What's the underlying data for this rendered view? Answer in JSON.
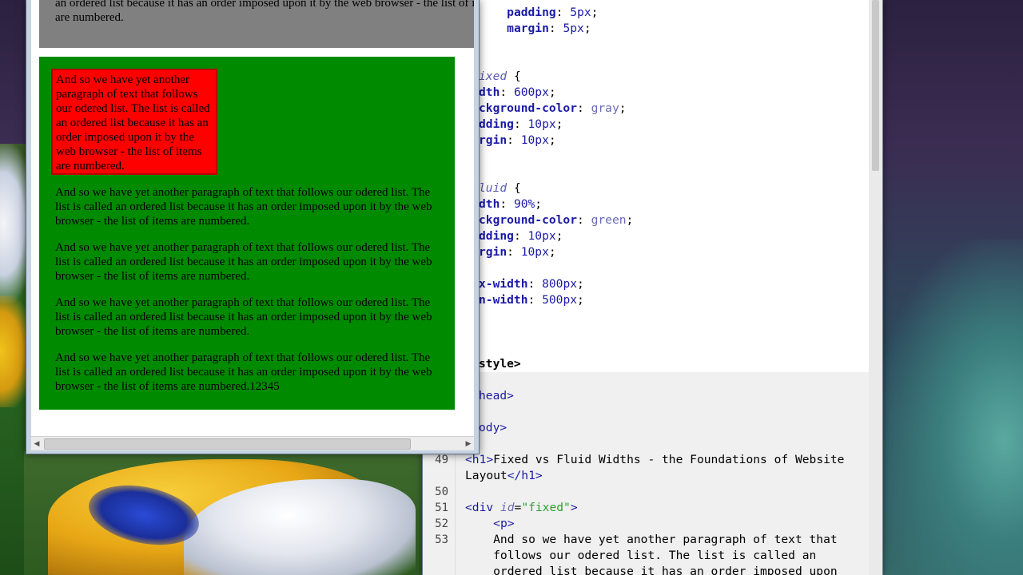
{
  "editor": {
    "top_lines": [
      {
        "parts": [
          [
            "prop",
            "padding"
          ],
          [
            "plain",
            ": "
          ],
          [
            "val-num",
            "5px"
          ],
          [
            "plain",
            ";"
          ]
        ],
        "indent": "    "
      },
      {
        "parts": [
          [
            "prop",
            "margin"
          ],
          [
            "plain",
            ": "
          ],
          [
            "val-num",
            "5px"
          ],
          [
            "plain",
            ";"
          ]
        ],
        "indent": "    "
      },
      {
        "parts": [],
        "indent": ""
      },
      {
        "parts": [],
        "indent": ""
      },
      {
        "parts": [
          [
            "sel",
            "ixed"
          ],
          [
            "plain",
            " {"
          ]
        ],
        "indent": ""
      },
      {
        "parts": [
          [
            "prop",
            "dth"
          ],
          [
            "plain",
            ": "
          ],
          [
            "val-num",
            "600px"
          ],
          [
            "plain",
            ";"
          ]
        ],
        "indent": ""
      },
      {
        "parts": [
          [
            "prop",
            "ckground-color"
          ],
          [
            "plain",
            ": "
          ],
          [
            "val-kw",
            "gray"
          ],
          [
            "plain",
            ";"
          ]
        ],
        "indent": ""
      },
      {
        "parts": [
          [
            "prop",
            "dding"
          ],
          [
            "plain",
            ": "
          ],
          [
            "val-num",
            "10px"
          ],
          [
            "plain",
            ";"
          ]
        ],
        "indent": ""
      },
      {
        "parts": [
          [
            "prop",
            "rgin"
          ],
          [
            "plain",
            ": "
          ],
          [
            "val-num",
            "10px"
          ],
          [
            "plain",
            ";"
          ]
        ],
        "indent": ""
      },
      {
        "parts": [],
        "indent": ""
      },
      {
        "parts": [],
        "indent": ""
      },
      {
        "parts": [
          [
            "sel",
            "luid"
          ],
          [
            "plain",
            " {"
          ]
        ],
        "indent": ""
      },
      {
        "parts": [
          [
            "prop",
            "dth"
          ],
          [
            "plain",
            ": "
          ],
          [
            "val-num",
            "90%"
          ],
          [
            "plain",
            ";"
          ]
        ],
        "indent": ""
      },
      {
        "parts": [
          [
            "prop",
            "ckground-color"
          ],
          [
            "plain",
            ": "
          ],
          [
            "val-kw",
            "green"
          ],
          [
            "plain",
            ";"
          ]
        ],
        "indent": ""
      },
      {
        "parts": [
          [
            "prop",
            "dding"
          ],
          [
            "plain",
            ": "
          ],
          [
            "val-num",
            "10px"
          ],
          [
            "plain",
            ";"
          ]
        ],
        "indent": ""
      },
      {
        "parts": [
          [
            "prop",
            "rgin"
          ],
          [
            "plain",
            ": "
          ],
          [
            "val-num",
            "10px"
          ],
          [
            "plain",
            ";"
          ]
        ],
        "indent": ""
      },
      {
        "parts": [],
        "indent": ""
      },
      {
        "parts": [
          [
            "prop",
            "x-width"
          ],
          [
            "plain",
            ": "
          ],
          [
            "val-num",
            "800px"
          ],
          [
            "plain",
            ";"
          ]
        ],
        "indent": ""
      },
      {
        "parts": [
          [
            "prop",
            "n-width"
          ],
          [
            "plain",
            ": "
          ],
          [
            "val-num",
            "500px"
          ],
          [
            "plain",
            ";"
          ]
        ],
        "indent": ""
      },
      {
        "parts": [],
        "indent": ""
      },
      {
        "parts": [],
        "indent": ""
      },
      {
        "parts": [],
        "indent": ""
      },
      {
        "parts": [
          [
            "plain-bold",
            "style>"
          ]
        ],
        "indent": ""
      },
      {
        "parts": [],
        "indent": ""
      },
      {
        "parts": [
          [
            "tag",
            "head>"
          ]
        ],
        "indent": ""
      },
      {
        "parts": [],
        "indent": ""
      },
      {
        "parts": [
          [
            "tag",
            "ody>"
          ]
        ],
        "indent": ""
      }
    ],
    "numbered_lines": [
      {
        "num": "49",
        "parts": [
          [
            "tag",
            "<h1>"
          ],
          [
            "plain",
            "Fixed vs Fluid Widths - the Foundations of Website"
          ]
        ]
      },
      {
        "num": "",
        "parts": [
          [
            "plain",
            "Layout"
          ],
          [
            "tag",
            "</h1>"
          ]
        ]
      },
      {
        "num": "50",
        "parts": []
      },
      {
        "num": "51",
        "parts": [
          [
            "tag",
            "<div "
          ],
          [
            "attr",
            "id"
          ],
          [
            "plain",
            "="
          ],
          [
            "str",
            "\"fixed\""
          ],
          [
            "tag",
            ">"
          ]
        ]
      },
      {
        "num": "52",
        "parts": [
          [
            "plain",
            "    "
          ],
          [
            "tag",
            "<p>"
          ]
        ]
      },
      {
        "num": "53",
        "parts": [
          [
            "plain",
            "    And so we have yet another paragraph of text that"
          ]
        ]
      },
      {
        "num": "",
        "parts": [
          [
            "plain",
            "    follows our odered list. The list is called an"
          ]
        ]
      },
      {
        "num": "",
        "parts": [
          [
            "plain",
            "    ordered list because it has an order imposed upon"
          ]
        ]
      }
    ]
  },
  "browser": {
    "fixed_text": "And so we have yet another paragraph of text that follows our odered list. The list is called an ordered list because it has an order imposed upon it by the web browser - the list of items are numbered.",
    "red_box_text": "And so we have yet another paragraph of text that follows our odered list. The list is called an ordered list because it has an order imposed upon it by the web browser - the list of items are numbered.",
    "fluid_paragraphs": [
      "And so we have yet another paragraph of text that follows our odered list. The list is called an ordered list because it has an order imposed upon it by the web browser - the list of items are numbered.",
      "And so we have yet another paragraph of text that follows our odered list. The list is called an ordered list because it has an order imposed upon it by the web browser - the list of items are numbered.",
      "And so we have yet another paragraph of text that follows our odered list. The list is called an ordered list because it has an order imposed upon it by the web browser - the list of items are numbered.",
      "And so we have yet another paragraph of text that follows our odered list. The list is called an ordered list because it has an order imposed upon it by the web browser - the list of items are numbered.12345"
    ],
    "scroll_left_glyph": "◀",
    "scroll_right_glyph": "▶"
  },
  "colors": {
    "fixed_bg": "#808080",
    "fluid_bg": "#008a00",
    "red_box_bg": "#ff0000"
  }
}
